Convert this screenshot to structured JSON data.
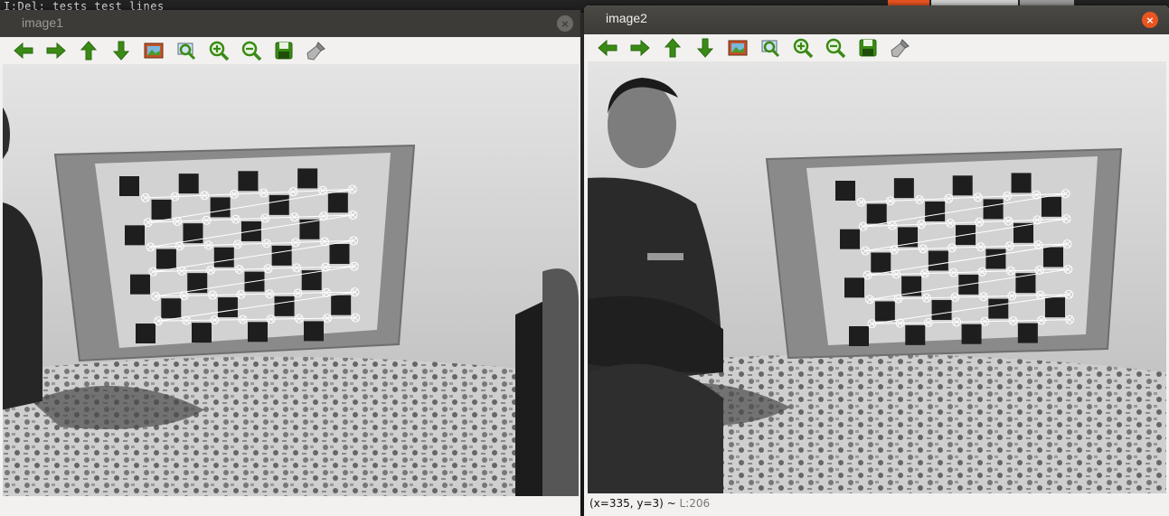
{
  "desktop": {
    "background_strip_text": "I:Del: tests test lines"
  },
  "colors": {
    "titlebar": "#3c3b37",
    "close_active": "#e95420",
    "icon_green": "#3a8a16",
    "window_bg": "#f2f1f0"
  },
  "windows": [
    {
      "id": "image1",
      "title": "image1",
      "active": false,
      "close_label": "×",
      "status": ""
    },
    {
      "id": "image2",
      "title": "image2",
      "active": true,
      "close_label": "×",
      "status_coords": "(x=335, y=3) ~ ",
      "status_level": "L:206"
    }
  ],
  "toolbar": [
    {
      "name": "pan-left",
      "icon": "arrow-left-icon"
    },
    {
      "name": "pan-right",
      "icon": "arrow-right-icon"
    },
    {
      "name": "pan-up",
      "icon": "arrow-up-icon"
    },
    {
      "name": "pan-down",
      "icon": "arrow-down-icon"
    },
    {
      "name": "zoom-to-fit",
      "icon": "picture-icon"
    },
    {
      "name": "zoom-to-region",
      "icon": "zoom-region-icon"
    },
    {
      "name": "zoom-in",
      "icon": "zoom-in-icon"
    },
    {
      "name": "zoom-out",
      "icon": "zoom-out-icon"
    },
    {
      "name": "save-image",
      "icon": "save-icon"
    },
    {
      "name": "properties",
      "icon": "brush-icon"
    }
  ]
}
